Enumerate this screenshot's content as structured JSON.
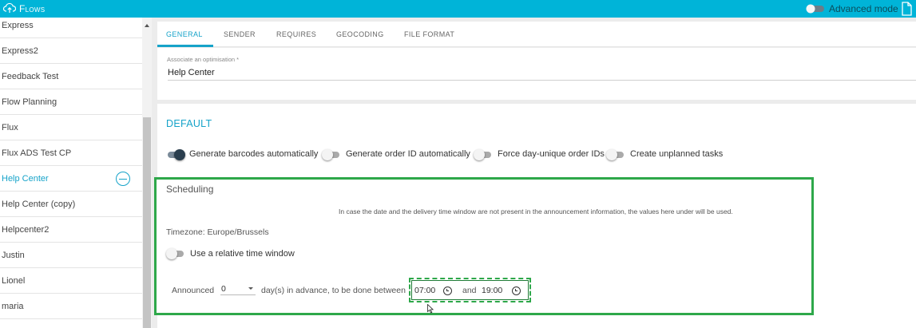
{
  "app": {
    "title": "Flows",
    "advanced_mode_label": "Advanced mode"
  },
  "sidebar": {
    "items": [
      {
        "label": "Express"
      },
      {
        "label": "Express2"
      },
      {
        "label": "Feedback Test"
      },
      {
        "label": "Flow Planning"
      },
      {
        "label": "Flux"
      },
      {
        "label": "Flux ADS Test CP"
      },
      {
        "label": "Help Center",
        "active": true
      },
      {
        "label": "Help Center (copy)"
      },
      {
        "label": "Helpcenter2"
      },
      {
        "label": "Justin"
      },
      {
        "label": "Lionel"
      },
      {
        "label": "maria"
      }
    ]
  },
  "tabs": [
    "GENERAL",
    "SENDER",
    "REQUIRES",
    "GEOCODING",
    "FILE FORMAT"
  ],
  "active_tab": "GENERAL",
  "optimisation": {
    "label": "Associate an optimisation *",
    "value": "Help Center"
  },
  "default_section": {
    "title": "DEFAULT",
    "toggles": [
      {
        "label": "Generate barcodes automatically",
        "on": true
      },
      {
        "label": "Generate order ID automatically",
        "on": false
      },
      {
        "label": "Force day-unique order IDs",
        "on": false
      },
      {
        "label": "Create unplanned tasks",
        "on": false
      }
    ]
  },
  "scheduling": {
    "title": "Scheduling",
    "note": "In case the date and the delivery time window are not present in the announcement information, the values here under will be used.",
    "timezone": "Timezone: Europe/Brussels",
    "relative_window_label": "Use a relative time window",
    "relative_window_on": false,
    "announced_label": "Announced",
    "days_value": "0",
    "mid_label": "day(s) in advance, to be done between",
    "start_time": "07:00",
    "and_label": "and",
    "end_time": "19:00"
  },
  "colors": {
    "accent": "#16a3c9",
    "topbar": "#00b4d8",
    "highlight": "#2ea84a"
  }
}
